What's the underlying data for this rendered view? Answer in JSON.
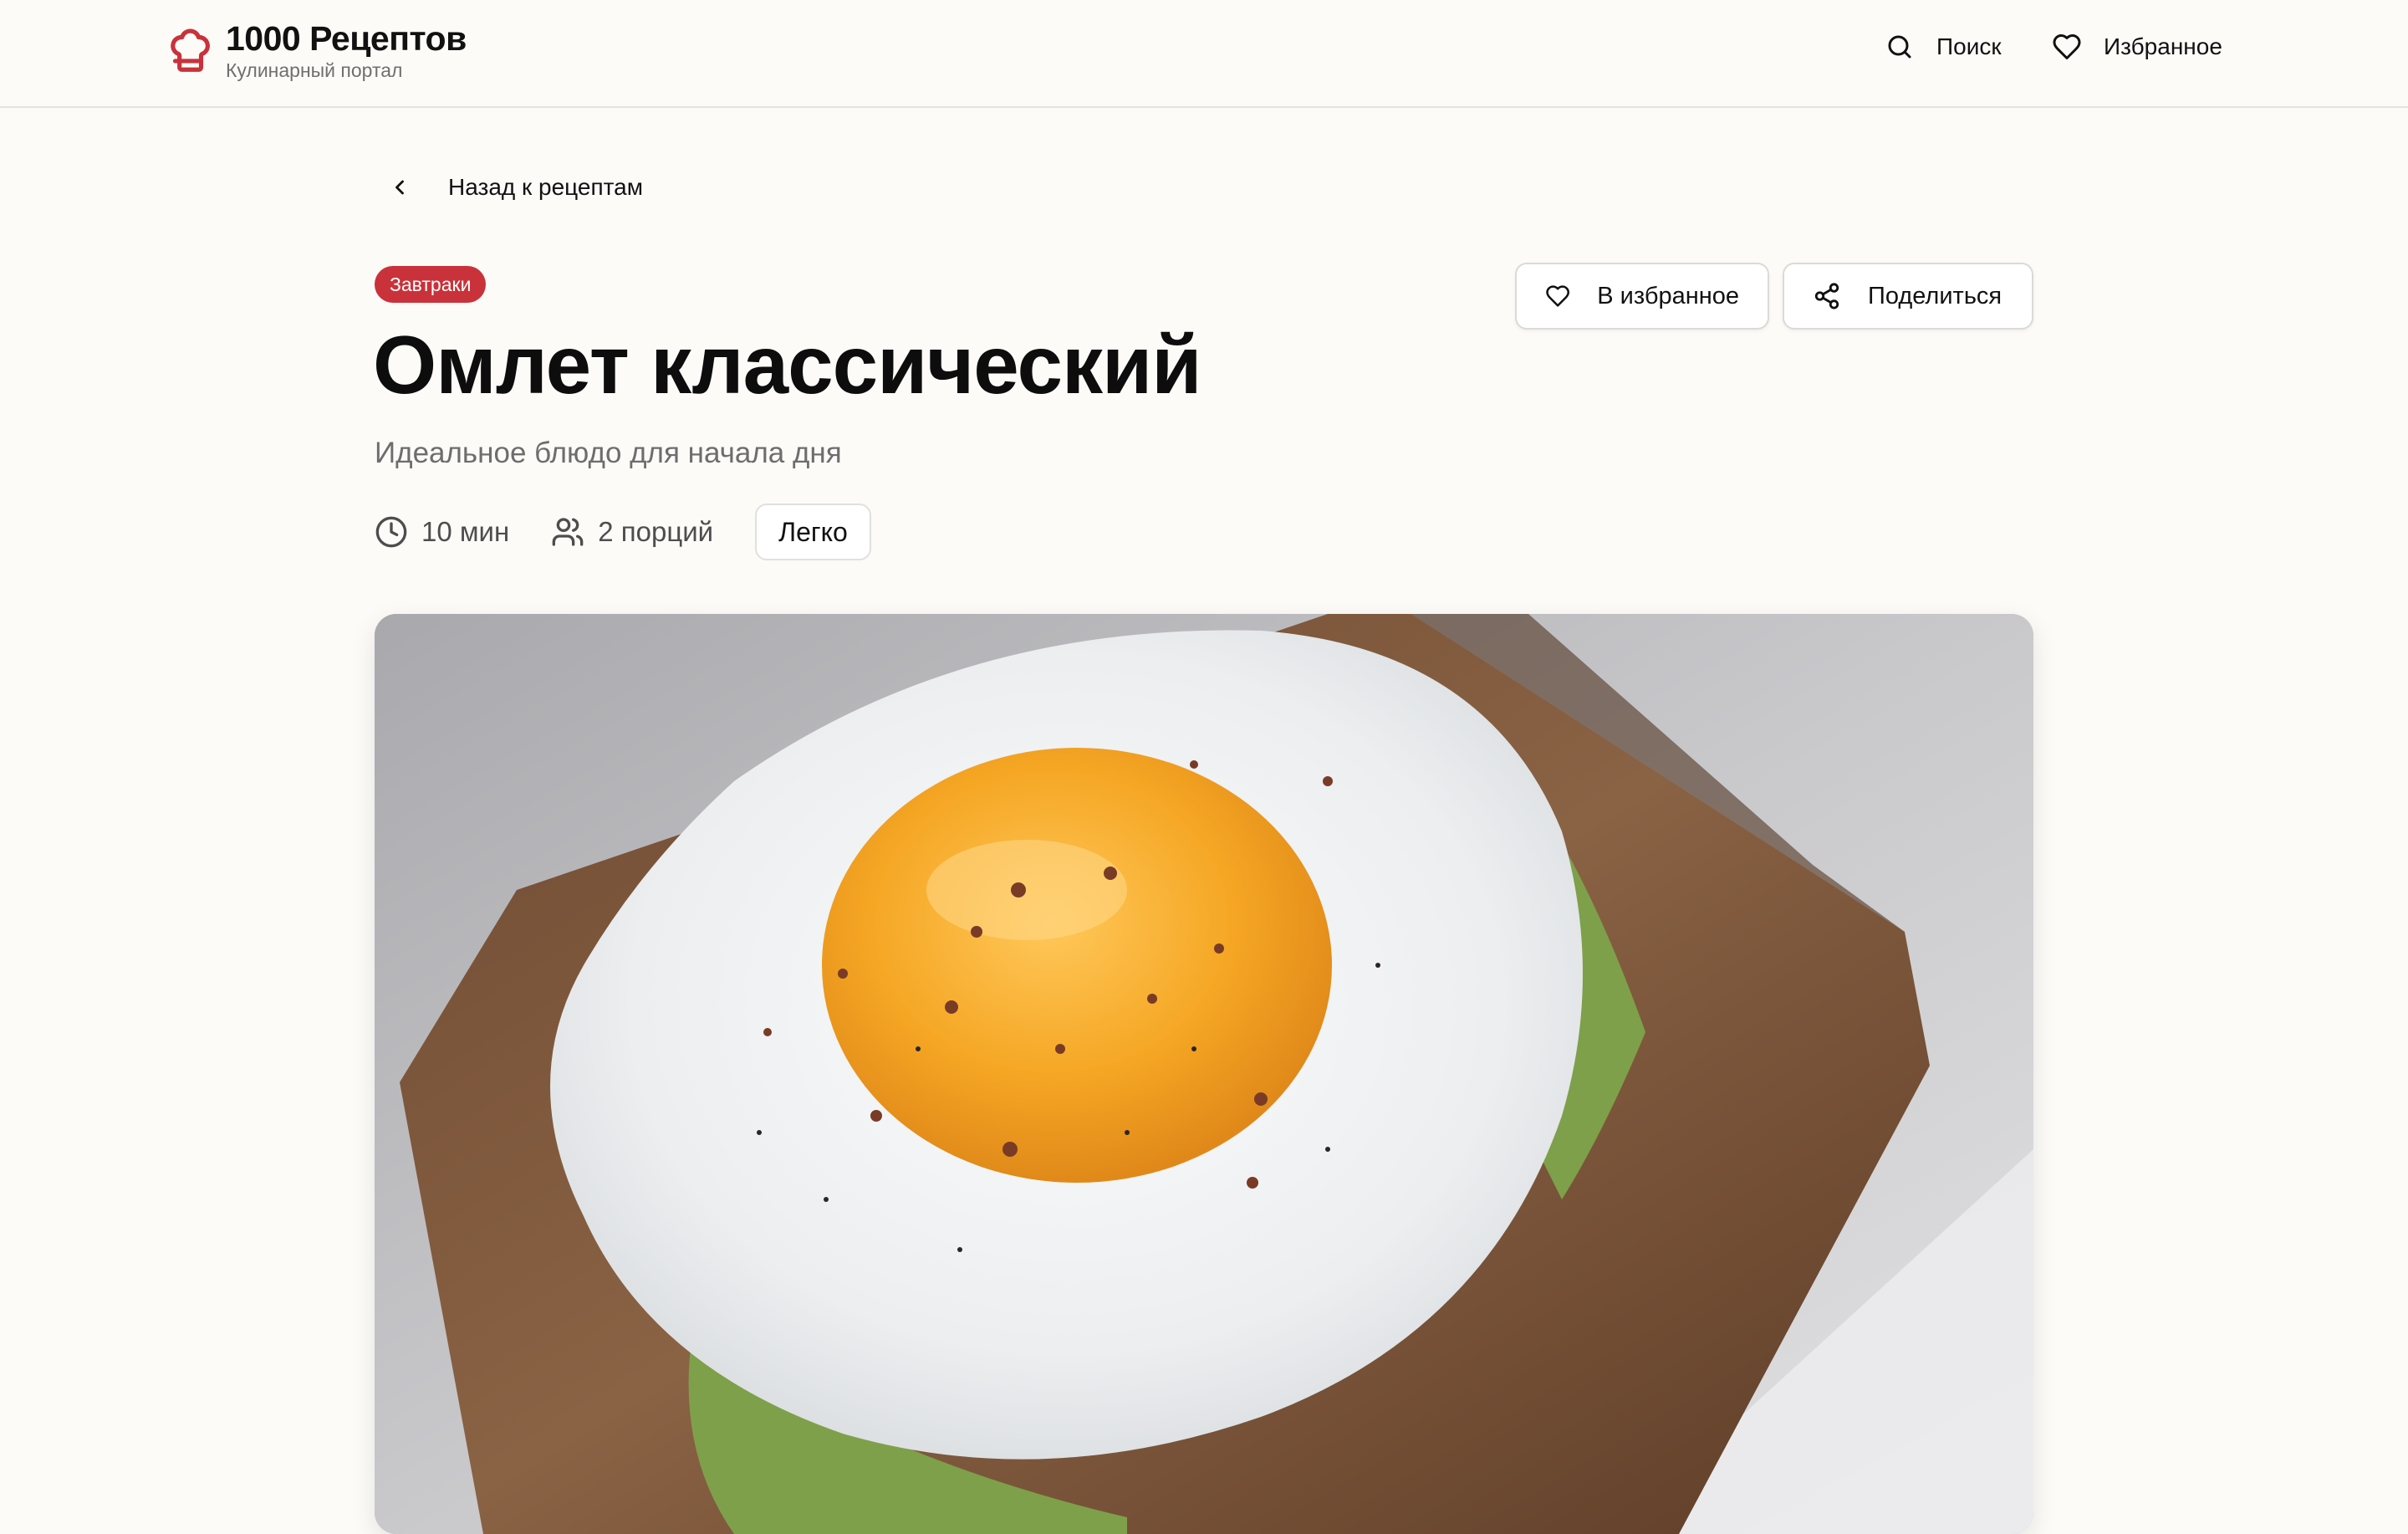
{
  "header": {
    "brand_title": "1000 Рецептов",
    "brand_subtitle": "Кулинарный портал",
    "logo_icon": "chef-hat-icon",
    "nav": {
      "search_label": "Поиск",
      "favorites_label": "Избранное"
    }
  },
  "back_link": {
    "label": "Назад к рецептам"
  },
  "recipe": {
    "category": "Завтраки",
    "title": "Омлет классический",
    "subtitle": "Идеальное блюдо для начала дня",
    "time": "10 мин",
    "servings": "2 порций",
    "difficulty": "Легко"
  },
  "actions": {
    "favorite_label": "В избранное",
    "share_label": "Поделиться"
  },
  "colors": {
    "accent": "#c9323a",
    "background": "#fcfbf8",
    "text": "#111111",
    "muted": "#6d6d6d"
  }
}
